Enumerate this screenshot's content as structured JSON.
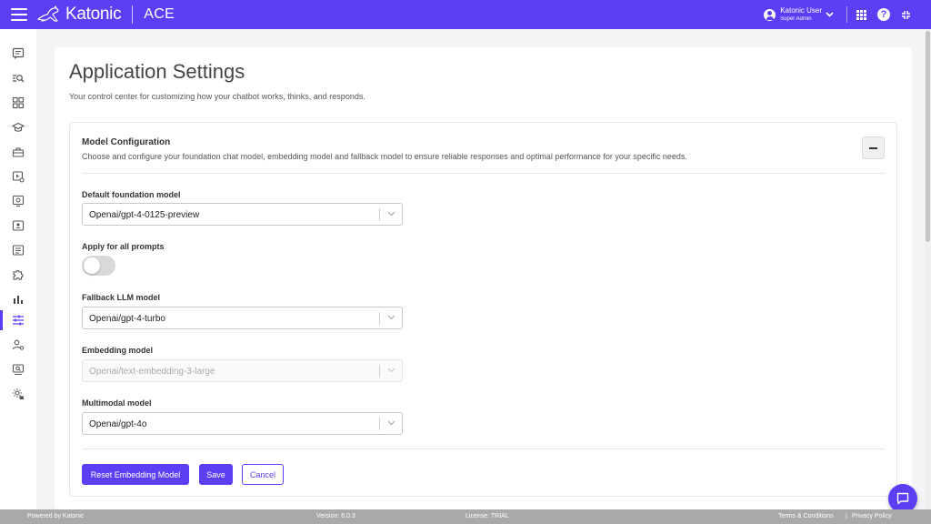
{
  "header": {
    "brand": "Katonic",
    "app_name": "ACE",
    "user_name": "Katonic User",
    "user_role": "Super Admin",
    "accent_color": "#5b3ff5"
  },
  "sidebar": {
    "items": [
      {
        "icon": "chat-icon"
      },
      {
        "icon": "search-list-icon"
      },
      {
        "icon": "grid-icon"
      },
      {
        "icon": "graduation-cap-icon"
      },
      {
        "icon": "toolbox-icon"
      },
      {
        "icon": "video-settings-icon"
      },
      {
        "icon": "bot-message-icon"
      },
      {
        "icon": "contact-card-icon"
      },
      {
        "icon": "document-list-icon"
      },
      {
        "icon": "puzzle-icon"
      },
      {
        "icon": "bar-chart-icon"
      },
      {
        "icon": "sliders-icon",
        "active": true
      },
      {
        "icon": "user-settings-icon"
      },
      {
        "icon": "monitor-search-icon"
      },
      {
        "icon": "gear-lock-icon"
      }
    ]
  },
  "page": {
    "title": "Application Settings",
    "subtitle": "Your control center for customizing how your chatbot works, thinks, and responds."
  },
  "section": {
    "title": "Model Configuration",
    "description": "Choose and configure your foundation chat model, embedding model and fallback model to ensure reliable responses and optimal performance for your specific needs."
  },
  "fields": {
    "default_model": {
      "label": "Default foundation model",
      "value": "Openai/gpt-4-0125-preview"
    },
    "apply_all": {
      "label": "Apply for all prompts",
      "enabled": false
    },
    "fallback_model": {
      "label": "Fallback LLM model",
      "value": "Openai/gpt-4-turbo"
    },
    "embedding_model": {
      "label": "Embedding model",
      "value": "Openai/text-embedding-3-large",
      "disabled": true
    },
    "multimodal_model": {
      "label": "Multimodal model",
      "value": "Openai/gpt-4o"
    }
  },
  "actions": {
    "reset_label": "Reset Embedding Model",
    "save_label": "Save",
    "cancel_label": "Cancel"
  },
  "footer": {
    "powered_by": "Powered by Katonic",
    "version": "Version: 6.0.3",
    "license": "License: TRIAL",
    "terms": "Terms & Conditions",
    "separator": "|",
    "privacy": "Privacy Policy"
  }
}
